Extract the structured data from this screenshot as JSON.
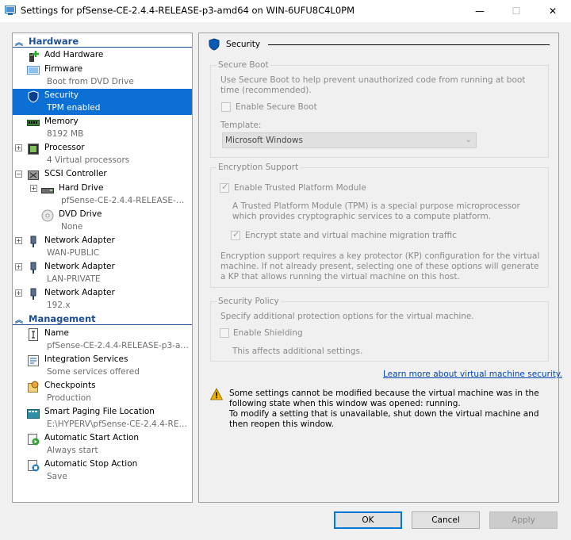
{
  "window": {
    "title": "Settings for pfSense-CE-2.4.4-RELEASE-p3-amd64 on WIN-6UFU8C4L0PM",
    "minimize": "—",
    "maximize": "☐",
    "close": "✕"
  },
  "sidebar": {
    "hardware_header": "Hardware",
    "management_header": "Management",
    "hardware": [
      {
        "label": "Add Hardware",
        "sub": "",
        "icon": "add-hardware-icon"
      },
      {
        "label": "Firmware",
        "sub": "Boot from DVD Drive",
        "icon": "firmware-icon"
      },
      {
        "label": "Security",
        "sub": "TPM enabled",
        "icon": "shield-icon",
        "selected": true
      },
      {
        "label": "Memory",
        "sub": "8192 MB",
        "icon": "memory-icon"
      },
      {
        "label": "Processor",
        "sub": "4 Virtual processors",
        "icon": "processor-icon"
      },
      {
        "label": "SCSI Controller",
        "sub": "",
        "icon": "scsi-controller-icon"
      },
      {
        "label": "Hard Drive",
        "sub": "pfSense-CE-2.4.4-RELEASE-p...",
        "icon": "hard-drive-icon"
      },
      {
        "label": "DVD Drive",
        "sub": "None",
        "icon": "dvd-drive-icon"
      },
      {
        "label": "Network Adapter",
        "sub": "WAN-PUBLIC",
        "icon": "network-adapter-icon"
      },
      {
        "label": "Network Adapter",
        "sub": "LAN-PRIVATE",
        "icon": "network-adapter-icon"
      },
      {
        "label": "Network Adapter",
        "sub": "192.x",
        "icon": "network-adapter-icon"
      }
    ],
    "management": [
      {
        "label": "Name",
        "sub": "pfSense-CE-2.4.4-RELEASE-p3-am...",
        "icon": "name-icon"
      },
      {
        "label": "Integration Services",
        "sub": "Some services offered",
        "icon": "integration-services-icon"
      },
      {
        "label": "Checkpoints",
        "sub": "Production",
        "icon": "checkpoints-icon"
      },
      {
        "label": "Smart Paging File Location",
        "sub": "E:\\HYPERV\\pfSense-CE-2.4.4-REL...",
        "icon": "smart-paging-icon"
      },
      {
        "label": "Automatic Start Action",
        "sub": "Always start",
        "icon": "auto-start-icon"
      },
      {
        "label": "Automatic Stop Action",
        "sub": "Save",
        "icon": "auto-stop-icon"
      }
    ]
  },
  "security": {
    "title": "Security",
    "secure_boot": {
      "title": "Secure Boot",
      "description": "Use Secure Boot to help prevent unauthorized code from running at boot time (recommended).",
      "enable_label": "Enable Secure Boot",
      "enable_checked": false,
      "template_label": "Template:",
      "template_value": "Microsoft Windows"
    },
    "encryption": {
      "title": "Encryption Support",
      "tpm_label": "Enable Trusted Platform Module",
      "tpm_checked": true,
      "tpm_description": "A Trusted Platform Module (TPM) is a special purpose microprocessor which provides cryptographic services to a compute platform.",
      "encrypt_label": "Encrypt state and virtual machine migration traffic",
      "encrypt_checked": true,
      "kp_note": "Encryption support requires a key protector (KP) configuration for the virtual machine. If not already present, selecting one of these options will generate a KP that allows running the virtual machine on this host."
    },
    "policy": {
      "title": "Security Policy",
      "description": "Specify additional protection options for the virtual machine.",
      "shielding_label": "Enable Shielding",
      "shielding_checked": false,
      "shielding_note": "This affects additional settings."
    },
    "learn_more": "Learn more about virtual machine security.",
    "warning_line1": "Some settings cannot be modified because the virtual machine was in the following state when this window was opened: running.",
    "warning_line2": "To modify a setting that is unavailable, shut down the virtual machine and then reopen this window."
  },
  "buttons": {
    "ok": "OK",
    "cancel": "Cancel",
    "apply": "Apply"
  }
}
